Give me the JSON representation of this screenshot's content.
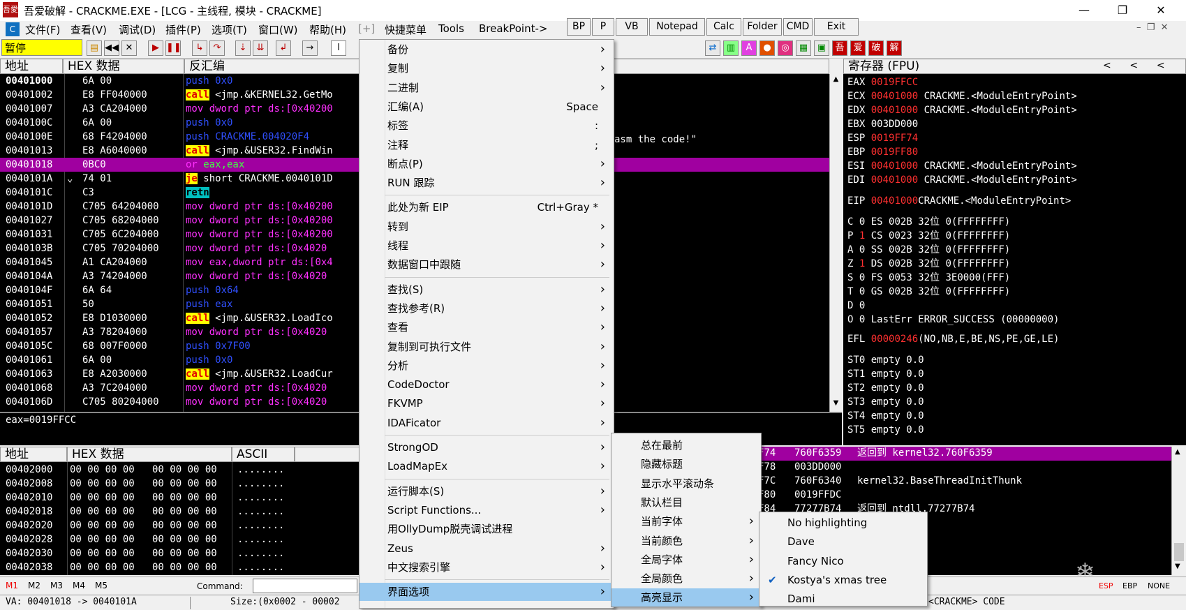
{
  "window": {
    "title": "吾爱破解 - CRACKME.EXE - [LCG - 主线程, 模块 - CRACKME]",
    "icon_text": "吾愛"
  },
  "menubar": {
    "items": [
      "文件(F)",
      "查看(V)",
      "调试(D)",
      "插件(P)",
      "选项(T)",
      "窗口(W)",
      "帮助(H)",
      "[+]",
      "快捷菜单",
      "Tools",
      "BreakPoint->"
    ],
    "buttons": [
      "BP",
      "P",
      "VB",
      "Notepad",
      "Calc",
      "Folder",
      "CMD",
      "Exit"
    ]
  },
  "toolbar": {
    "status": "暂停"
  },
  "disasm": {
    "headers": [
      "地址",
      "HEX 数据",
      "反汇编"
    ],
    "rows": [
      {
        "addr": "00401000",
        "hex": "6A 00",
        "op": "push",
        "args": " 0x0"
      },
      {
        "addr": "00401002",
        "hex": "E8 FF040000",
        "op": "call",
        "args": " <jmp.&KERNEL32.GetMo"
      },
      {
        "addr": "00401007",
        "hex": "A3 CA204000",
        "op": "mov",
        "args": " dword ptr ds:[0x40200"
      },
      {
        "addr": "0040100C",
        "hex": "6A 00",
        "op": "push",
        "args": " 0x0"
      },
      {
        "addr": "0040100E",
        "hex": "68 F4204000",
        "op": "push",
        "args": " CRACKME.004020F4"
      },
      {
        "addr": "00401013",
        "hex": "E8 A6040000",
        "op": "call",
        "args": " <jmp.&USER32.FindWin"
      },
      {
        "addr": "00401018",
        "hex": "0BC0",
        "op": "or",
        "args": " eax,eax"
      },
      {
        "addr": "0040101A",
        "hex": "74 01",
        "op": "je",
        "args": " short CRACKME.0040101D"
      },
      {
        "addr": "0040101C",
        "hex": "C3",
        "op": "retn",
        "args": ""
      },
      {
        "addr": "0040101D",
        "hex": "C705 64204000",
        "op": "mov",
        "args": " dword ptr ds:[0x40200"
      },
      {
        "addr": "00401027",
        "hex": "C705 68204000",
        "op": "mov",
        "args": " dword ptr ds:[0x40200"
      },
      {
        "addr": "00401031",
        "hex": "C705 6C204000",
        "op": "mov",
        "args": " dword ptr ds:[0x40200"
      },
      {
        "addr": "0040103B",
        "hex": "C705 70204000",
        "op": "mov",
        "args": " dword ptr ds:[0x4020"
      },
      {
        "addr": "00401045",
        "hex": "A1 CA204000",
        "op": "mov",
        "args": " eax,dword ptr ds:[0x4"
      },
      {
        "addr": "0040104A",
        "hex": "A3 74204000",
        "op": "mov",
        "args": " dword ptr ds:[0x4020"
      },
      {
        "addr": "0040104F",
        "hex": "6A 64",
        "op": "push",
        "args": " 0x64"
      },
      {
        "addr": "00401051",
        "hex": "50",
        "op": "push",
        "args": " eax"
      },
      {
        "addr": "00401052",
        "hex": "E8 D1030000",
        "op": "call",
        "args": " <jmp.&USER32.LoadIco"
      },
      {
        "addr": "00401057",
        "hex": "A3 78204000",
        "op": "mov",
        "args": " dword ptr ds:[0x4020"
      },
      {
        "addr": "0040105C",
        "hex": "68 007F0000",
        "op": "push",
        "args": " 0x7F00"
      },
      {
        "addr": "00401061",
        "hex": "6A 00",
        "op": "push",
        "args": " 0x0"
      },
      {
        "addr": "00401063",
        "hex": "E8 A2030000",
        "op": "call",
        "args": " <jmp.&USER32.LoadCur"
      },
      {
        "addr": "00401068",
        "hex": "A3 7C204000",
        "op": "mov",
        "args": " dword ptr ds:[0x4020"
      },
      {
        "addr": "0040106D",
        "hex": "C705 80204000",
        "op": "mov",
        "args": " dword ptr ds:[0x4020"
      }
    ],
    "comment": "asm the code!\"",
    "info": "eax=0019FFCC"
  },
  "registers": {
    "header": "寄存器 (FPU)",
    "lines": [
      {
        "n": "EAX",
        "v": "0019FFCC",
        "t": ""
      },
      {
        "n": "ECX",
        "v": "00401000",
        "t": "CRACKME.<ModuleEntryPoint>"
      },
      {
        "n": "EDX",
        "v": "00401000",
        "t": "CRACKME.<ModuleEntryPoint>"
      },
      {
        "n": "EBX",
        "v": "",
        "t": "003DD000"
      },
      {
        "n": "ESP",
        "v": "0019FF74",
        "t": ""
      },
      {
        "n": "EBP",
        "v": "0019FF80",
        "t": ""
      },
      {
        "n": "ESI",
        "v": "00401000",
        "t": "CRACKME.<ModuleEntryPoint>"
      },
      {
        "n": "EDI",
        "v": "00401000",
        "t": "CRACKME.<ModuleEntryPoint>"
      }
    ],
    "eip": {
      "n": "EIP",
      "v": "00401000",
      "t": "CRACKME.<ModuleEntryPoint>"
    },
    "flags": [
      {
        "f": "C",
        "v": "0",
        "red": false,
        "s": "ES 002B 32位 0(FFFFFFFF)"
      },
      {
        "f": "P",
        "v": "1",
        "red": true,
        "s": "CS 0023 32位 0(FFFFFFFF)"
      },
      {
        "f": "A",
        "v": "0",
        "red": false,
        "s": "SS 002B 32位 0(FFFFFFFF)"
      },
      {
        "f": "Z",
        "v": "1",
        "red": true,
        "s": "DS 002B 32位 0(FFFFFFFF)"
      },
      {
        "f": "S",
        "v": "0",
        "red": false,
        "s": "FS 0053 32位 3E0000(FFF)"
      },
      {
        "f": "T",
        "v": "0",
        "red": false,
        "s": "GS 002B 32位 0(FFFFFFFF)"
      },
      {
        "f": "D",
        "v": "0",
        "red": false,
        "s": ""
      },
      {
        "f": "O",
        "v": "0",
        "red": false,
        "s": "LastErr ERROR_SUCCESS (00000000)"
      }
    ],
    "efl": {
      "n": "EFL",
      "v": "00000246",
      "t": "(NO,NB,E,BE,NS,PE,GE,LE)"
    },
    "st": [
      "ST0 empty 0.0",
      "ST1 empty 0.0",
      "ST2 empty 0.0",
      "ST3 empty 0.0",
      "ST4 empty 0.0",
      "ST5 empty 0.0"
    ]
  },
  "dump": {
    "headers": [
      "地址",
      "HEX 数据",
      "ASCII"
    ],
    "rows": [
      {
        "a": "00402000",
        "h1": "00 00 00 00",
        "h2": "00 00 00 00",
        "s": "........"
      },
      {
        "a": "00402008",
        "h1": "00 00 00 00",
        "h2": "00 00 00 00",
        "s": "........"
      },
      {
        "a": "00402010",
        "h1": "00 00 00 00",
        "h2": "00 00 00 00",
        "s": "........"
      },
      {
        "a": "00402018",
        "h1": "00 00 00 00",
        "h2": "00 00 00 00",
        "s": "........"
      },
      {
        "a": "00402020",
        "h1": "00 00 00 00",
        "h2": "00 00 00 00",
        "s": "........"
      },
      {
        "a": "00402028",
        "h1": "00 00 00 00",
        "h2": "00 00 00 00",
        "s": "........"
      },
      {
        "a": "00402030",
        "h1": "00 00 00 00",
        "h2": "00 00 00 00",
        "s": "........"
      },
      {
        "a": "00402038",
        "h1": "00 00 00 00",
        "h2": "00 00 00 00",
        "s": "........"
      }
    ]
  },
  "stack": {
    "rows": [
      {
        "a": "F74",
        "v": "760F6359",
        "c": "返回到 kernel32.760F6359"
      },
      {
        "a": "F78",
        "v": "003DD000",
        "c": ""
      },
      {
        "a": "F7C",
        "v": "760F6340",
        "c": "kernel32.BaseThreadInitThunk"
      },
      {
        "a": "F80",
        "v": "0019FFDC",
        "c": ""
      },
      {
        "a": "F84",
        "v": "77277B74",
        "c": "返回到 ntdll.77277B74"
      }
    ]
  },
  "context_menu": {
    "items": [
      {
        "label": "备份",
        "shortcut": "",
        "sub": true
      },
      {
        "label": "复制",
        "shortcut": "",
        "sub": true
      },
      {
        "label": "二进制",
        "shortcut": "",
        "sub": true
      },
      {
        "label": "汇编(A)",
        "shortcut": "Space",
        "sub": false
      },
      {
        "label": "标签",
        "shortcut": ":",
        "sub": false
      },
      {
        "label": "注释",
        "shortcut": ";",
        "sub": false
      },
      {
        "label": "断点(P)",
        "shortcut": "",
        "sub": true
      },
      {
        "label": "RUN 跟踪",
        "shortcut": "",
        "sub": true
      },
      {
        "label": "此处为新 EIP",
        "shortcut": "Ctrl+Gray *",
        "sub": false
      },
      {
        "label": "转到",
        "shortcut": "",
        "sub": true
      },
      {
        "label": "线程",
        "shortcut": "",
        "sub": true
      },
      {
        "label": "数据窗口中跟随",
        "shortcut": "",
        "sub": true
      },
      {
        "label": "查找(S)",
        "shortcut": "",
        "sub": true
      },
      {
        "label": "查找参考(R)",
        "shortcut": "",
        "sub": true
      },
      {
        "label": "查看",
        "shortcut": "",
        "sub": true
      },
      {
        "label": "复制到可执行文件",
        "shortcut": "",
        "sub": true
      },
      {
        "label": "分析",
        "shortcut": "",
        "sub": true
      },
      {
        "label": "CodeDoctor",
        "shortcut": "",
        "sub": true
      },
      {
        "label": "FKVMP",
        "shortcut": "",
        "sub": true
      },
      {
        "label": "IDAFicator",
        "shortcut": "",
        "sub": true
      },
      {
        "label": "StrongOD",
        "shortcut": "",
        "sub": true
      },
      {
        "label": "LoadMapEx",
        "shortcut": "",
        "sub": true
      },
      {
        "label": "运行脚本(S)",
        "shortcut": "",
        "sub": true
      },
      {
        "label": "Script Functions...",
        "shortcut": "",
        "sub": true
      },
      {
        "label": "用OllyDump脱壳调试进程",
        "shortcut": "",
        "sub": false
      },
      {
        "label": "Zeus",
        "shortcut": "",
        "sub": true
      },
      {
        "label": "中文搜索引擎",
        "shortcut": "",
        "sub": true
      },
      {
        "label": "界面选项",
        "shortcut": "",
        "sub": true
      }
    ]
  },
  "submenu1": {
    "items": [
      {
        "label": "总在最前",
        "sub": false
      },
      {
        "label": "隐藏标题",
        "sub": false
      },
      {
        "label": "显示水平滚动条",
        "sub": false
      },
      {
        "label": "默认栏目",
        "sub": false
      },
      {
        "label": "当前字体",
        "sub": true
      },
      {
        "label": "当前颜色",
        "sub": true
      },
      {
        "label": "全局字体",
        "sub": true
      },
      {
        "label": "全局颜色",
        "sub": true
      },
      {
        "label": "高亮显示",
        "sub": true
      }
    ]
  },
  "submenu2": {
    "items": [
      "No highlighting",
      "Dave",
      "Fancy Nico",
      "Kostya's xmas tree",
      "Dami"
    ],
    "checked": "Kostya's xmas tree"
  },
  "bottom": {
    "tabs": [
      "M1",
      "M2",
      "M3",
      "M4",
      "M5"
    ],
    "command_label": "Command:",
    "status_left": "VA: 00401018 -> 0040101A",
    "status_mid": "Size:(0x0002 - 00002",
    "status_right": "<CRACKME> CODE",
    "esp_ebp": [
      "ESP",
      "EBP",
      "NONE"
    ]
  },
  "colors": {
    "selection": "#a000a0",
    "menu_highlight": "#99c9ef",
    "paused": "#ffff00"
  }
}
